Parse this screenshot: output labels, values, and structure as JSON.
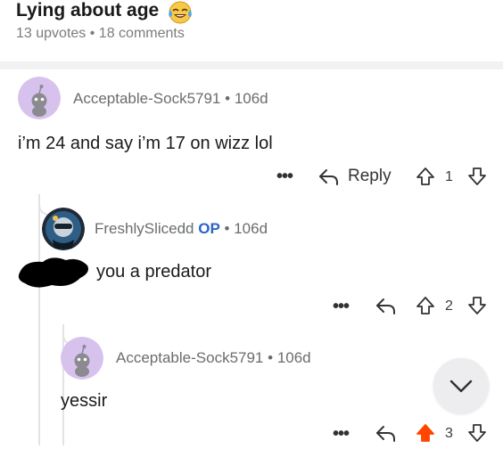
{
  "post": {
    "title": "Lying about age",
    "emoji_icon": "face-with-tears-of-joy",
    "upvotes": "13 upvotes",
    "meta_separator": "•",
    "comments": "18 comments"
  },
  "comments": [
    {
      "username": "Acceptable-Sock5791",
      "separator": "•",
      "age": "106d",
      "text": "i’m 24 and say i’m 17 on wizz lol",
      "actions": {
        "dots": "•••",
        "reply_label": "Reply",
        "score": "1",
        "upvoted": false
      }
    },
    {
      "username": "FreshlySlicedd",
      "badge": "OP",
      "separator": "•",
      "age": "106d",
      "text": "you a predator",
      "actions": {
        "dots": "•••",
        "score": "2",
        "upvoted": false
      }
    },
    {
      "username": "Acceptable-Sock5791",
      "separator": "•",
      "age": "106d",
      "text": "yessir",
      "actions": {
        "dots": "•••",
        "score": "3",
        "upvoted": true
      }
    }
  ],
  "colors": {
    "upvote_active": "#ff4500",
    "op_badge": "#2b63c8",
    "avatar_bg": "#d7c2ee"
  }
}
